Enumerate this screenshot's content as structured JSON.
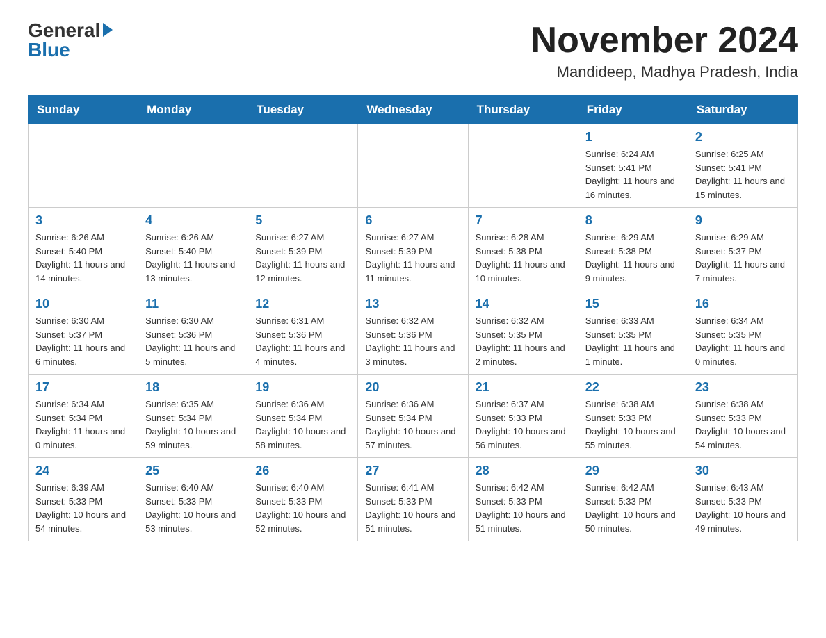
{
  "header": {
    "logo_general": "General",
    "logo_blue": "Blue",
    "month_title": "November 2024",
    "location": "Mandideep, Madhya Pradesh, India"
  },
  "weekdays": [
    "Sunday",
    "Monday",
    "Tuesday",
    "Wednesday",
    "Thursday",
    "Friday",
    "Saturday"
  ],
  "weeks": [
    [
      {
        "day": "",
        "info": ""
      },
      {
        "day": "",
        "info": ""
      },
      {
        "day": "",
        "info": ""
      },
      {
        "day": "",
        "info": ""
      },
      {
        "day": "",
        "info": ""
      },
      {
        "day": "1",
        "info": "Sunrise: 6:24 AM\nSunset: 5:41 PM\nDaylight: 11 hours and 16 minutes."
      },
      {
        "day": "2",
        "info": "Sunrise: 6:25 AM\nSunset: 5:41 PM\nDaylight: 11 hours and 15 minutes."
      }
    ],
    [
      {
        "day": "3",
        "info": "Sunrise: 6:26 AM\nSunset: 5:40 PM\nDaylight: 11 hours and 14 minutes."
      },
      {
        "day": "4",
        "info": "Sunrise: 6:26 AM\nSunset: 5:40 PM\nDaylight: 11 hours and 13 minutes."
      },
      {
        "day": "5",
        "info": "Sunrise: 6:27 AM\nSunset: 5:39 PM\nDaylight: 11 hours and 12 minutes."
      },
      {
        "day": "6",
        "info": "Sunrise: 6:27 AM\nSunset: 5:39 PM\nDaylight: 11 hours and 11 minutes."
      },
      {
        "day": "7",
        "info": "Sunrise: 6:28 AM\nSunset: 5:38 PM\nDaylight: 11 hours and 10 minutes."
      },
      {
        "day": "8",
        "info": "Sunrise: 6:29 AM\nSunset: 5:38 PM\nDaylight: 11 hours and 9 minutes."
      },
      {
        "day": "9",
        "info": "Sunrise: 6:29 AM\nSunset: 5:37 PM\nDaylight: 11 hours and 7 minutes."
      }
    ],
    [
      {
        "day": "10",
        "info": "Sunrise: 6:30 AM\nSunset: 5:37 PM\nDaylight: 11 hours and 6 minutes."
      },
      {
        "day": "11",
        "info": "Sunrise: 6:30 AM\nSunset: 5:36 PM\nDaylight: 11 hours and 5 minutes."
      },
      {
        "day": "12",
        "info": "Sunrise: 6:31 AM\nSunset: 5:36 PM\nDaylight: 11 hours and 4 minutes."
      },
      {
        "day": "13",
        "info": "Sunrise: 6:32 AM\nSunset: 5:36 PM\nDaylight: 11 hours and 3 minutes."
      },
      {
        "day": "14",
        "info": "Sunrise: 6:32 AM\nSunset: 5:35 PM\nDaylight: 11 hours and 2 minutes."
      },
      {
        "day": "15",
        "info": "Sunrise: 6:33 AM\nSunset: 5:35 PM\nDaylight: 11 hours and 1 minute."
      },
      {
        "day": "16",
        "info": "Sunrise: 6:34 AM\nSunset: 5:35 PM\nDaylight: 11 hours and 0 minutes."
      }
    ],
    [
      {
        "day": "17",
        "info": "Sunrise: 6:34 AM\nSunset: 5:34 PM\nDaylight: 11 hours and 0 minutes."
      },
      {
        "day": "18",
        "info": "Sunrise: 6:35 AM\nSunset: 5:34 PM\nDaylight: 10 hours and 59 minutes."
      },
      {
        "day": "19",
        "info": "Sunrise: 6:36 AM\nSunset: 5:34 PM\nDaylight: 10 hours and 58 minutes."
      },
      {
        "day": "20",
        "info": "Sunrise: 6:36 AM\nSunset: 5:34 PM\nDaylight: 10 hours and 57 minutes."
      },
      {
        "day": "21",
        "info": "Sunrise: 6:37 AM\nSunset: 5:33 PM\nDaylight: 10 hours and 56 minutes."
      },
      {
        "day": "22",
        "info": "Sunrise: 6:38 AM\nSunset: 5:33 PM\nDaylight: 10 hours and 55 minutes."
      },
      {
        "day": "23",
        "info": "Sunrise: 6:38 AM\nSunset: 5:33 PM\nDaylight: 10 hours and 54 minutes."
      }
    ],
    [
      {
        "day": "24",
        "info": "Sunrise: 6:39 AM\nSunset: 5:33 PM\nDaylight: 10 hours and 54 minutes."
      },
      {
        "day": "25",
        "info": "Sunrise: 6:40 AM\nSunset: 5:33 PM\nDaylight: 10 hours and 53 minutes."
      },
      {
        "day": "26",
        "info": "Sunrise: 6:40 AM\nSunset: 5:33 PM\nDaylight: 10 hours and 52 minutes."
      },
      {
        "day": "27",
        "info": "Sunrise: 6:41 AM\nSunset: 5:33 PM\nDaylight: 10 hours and 51 minutes."
      },
      {
        "day": "28",
        "info": "Sunrise: 6:42 AM\nSunset: 5:33 PM\nDaylight: 10 hours and 51 minutes."
      },
      {
        "day": "29",
        "info": "Sunrise: 6:42 AM\nSunset: 5:33 PM\nDaylight: 10 hours and 50 minutes."
      },
      {
        "day": "30",
        "info": "Sunrise: 6:43 AM\nSunset: 5:33 PM\nDaylight: 10 hours and 49 minutes."
      }
    ]
  ]
}
